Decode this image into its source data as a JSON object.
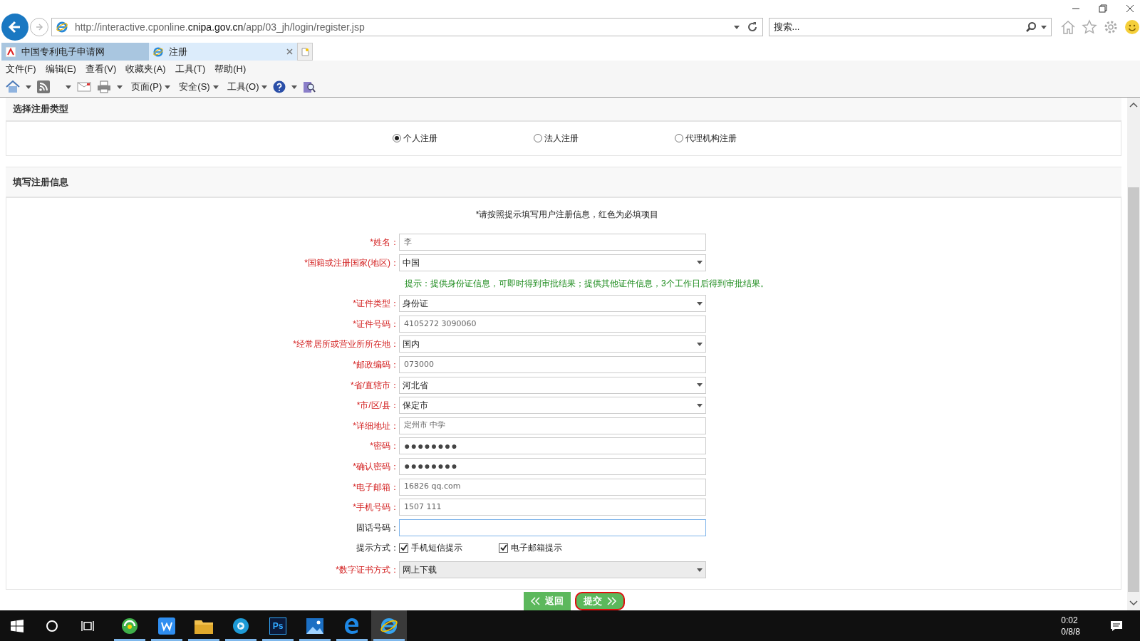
{
  "browser": {
    "url": "http://interactive.cponline.**cnipa.gov.cn**/app/03_jh/login/register.jsp",
    "search": {
      "placeholder": "搜索..."
    },
    "tabs": [
      {
        "label": "中国专利电子申请网",
        "selected": false
      },
      {
        "label": "注册",
        "selected": true
      }
    ],
    "menu": [
      "文件(F)",
      "编辑(E)",
      "查看(V)",
      "收藏夹(A)",
      "工具(T)",
      "帮助(H)"
    ],
    "toolbar": [
      "页面(P)",
      "安全(S)",
      "工具(O)"
    ]
  },
  "register_type": {
    "title": "选择注册类型",
    "options": [
      {
        "label": "个人注册",
        "selected": true
      },
      {
        "label": "法人注册",
        "selected": false
      },
      {
        "label": "代理机构注册",
        "selected": false
      }
    ]
  },
  "form": {
    "title": "填写注册信息",
    "note": "*请按照提示填写用户注册信息，红色为必填项目",
    "fields": [
      {
        "kind": "text",
        "label": "*姓名：",
        "required": true,
        "value": "李"
      },
      {
        "kind": "select",
        "label": "*国籍或注册国家(地区)：",
        "required": true,
        "value": "中国",
        "disabled": false
      },
      {
        "kind": "hint",
        "text": "提示：提供身份证信息，可即时得到审批结果；提供其他证件信息，3个工作日后得到审批结果。"
      },
      {
        "kind": "select",
        "label": "*证件类型：",
        "required": true,
        "value": "身份证",
        "disabled": false
      },
      {
        "kind": "text",
        "label": "*证件号码：",
        "required": true,
        "value": "4105272 3090060"
      },
      {
        "kind": "select",
        "label": "*经常居所或营业所所在地：",
        "required": true,
        "value": "国内",
        "disabled": false
      },
      {
        "kind": "text",
        "label": "*邮政编码：",
        "required": true,
        "value": "073000"
      },
      {
        "kind": "select",
        "label": "*省/直辖市：",
        "required": true,
        "value": "河北省",
        "disabled": false
      },
      {
        "kind": "select",
        "label": "*市/区/县：",
        "required": true,
        "value": "保定市",
        "disabled": false
      },
      {
        "kind": "text",
        "label": "*详细地址：",
        "required": true,
        "value": "定州市 中学"
      },
      {
        "kind": "password",
        "label": "*密码：",
        "required": true,
        "value": "●●●●●●●●"
      },
      {
        "kind": "password",
        "label": "*确认密码：",
        "required": true,
        "value": "●●●●●●●●"
      },
      {
        "kind": "text",
        "label": "*电子邮箱：",
        "required": true,
        "value": "16826 qq.com"
      },
      {
        "kind": "text",
        "label": "*手机号码：",
        "required": true,
        "value": "1507 111"
      },
      {
        "kind": "text",
        "label": "固话号码：",
        "required": false,
        "focused": true
      },
      {
        "kind": "checks",
        "label": "提示方式：",
        "required": false,
        "options": [
          {
            "label": "手机短信提示",
            "checked": true
          },
          {
            "label": "电子邮箱提示",
            "checked": true
          }
        ]
      },
      {
        "kind": "select",
        "label": "*数字证书方式：",
        "required": true,
        "value": "网上下载",
        "disabled": true
      }
    ],
    "buttons": [
      {
        "label": "返回",
        "kind": "back",
        "highlighted": false
      },
      {
        "label": "提交",
        "kind": "submit",
        "highlighted": true
      }
    ]
  },
  "taskbar": {
    "apps": [
      {
        "kind": "browser360",
        "active": false
      },
      {
        "kind": "writer",
        "active": false
      },
      {
        "kind": "folder",
        "active": false
      },
      {
        "kind": "player",
        "active": false
      },
      {
        "kind": "ps",
        "label": "Ps",
        "active": false
      },
      {
        "kind": "photos",
        "active": false
      },
      {
        "kind": "edge",
        "active": false
      },
      {
        "kind": "ie",
        "active": true
      }
    ],
    "time": "0:02",
    "date": "0/8/8"
  }
}
